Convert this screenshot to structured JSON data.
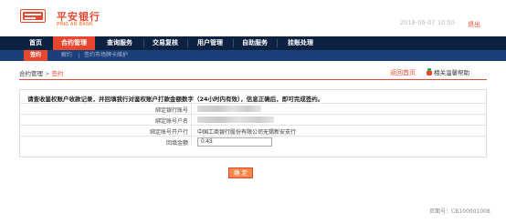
{
  "header": {
    "brand_cn": "平安银行",
    "brand_en": "PING AN BANK",
    "datetime": "2018-06-07  10:50",
    "logout": "退出"
  },
  "nav": {
    "items": [
      {
        "label": "首页",
        "active": false
      },
      {
        "label": "合约管理",
        "active": true
      },
      {
        "label": "查询服务",
        "active": false
      },
      {
        "label": "交易复核",
        "active": false
      },
      {
        "label": "用户管理",
        "active": false
      },
      {
        "label": "自助服务",
        "active": false
      },
      {
        "label": "挂账处理",
        "active": false
      }
    ]
  },
  "subnav": {
    "items": [
      {
        "label": "签约",
        "active": true
      },
      {
        "label": "解约",
        "active": false
      },
      {
        "label": "签约市场牌卡维护",
        "active": false
      }
    ]
  },
  "breadcrumb": {
    "root": "合约管理",
    "separator": ">",
    "current": "签约"
  },
  "actions": {
    "back_home": "返回首页",
    "help": "相关温馨帮助"
  },
  "form": {
    "notice": "请查收鉴权账户收款记录，并回填我行对鉴权账户打款金额数字（24小时内有效），信息正确后，即可完成签约。",
    "rows": [
      {
        "label": "绑定银行账号",
        "value": ""
      },
      {
        "label": "绑定账号户名",
        "value": ""
      },
      {
        "label": "绑定账号开户行",
        "value": "中国工商银行股份有限公司无锡新安支行"
      },
      {
        "label": "回填金额",
        "value": "0.43"
      }
    ]
  },
  "confirm_button": "确 定",
  "page_number": "页面号：CB100001008",
  "colors": {
    "brand_red": "#e8472f",
    "nav_navy": "#0d2240",
    "subnav_blue": "#1a3f7a",
    "button_orange": "#f08a4b"
  }
}
